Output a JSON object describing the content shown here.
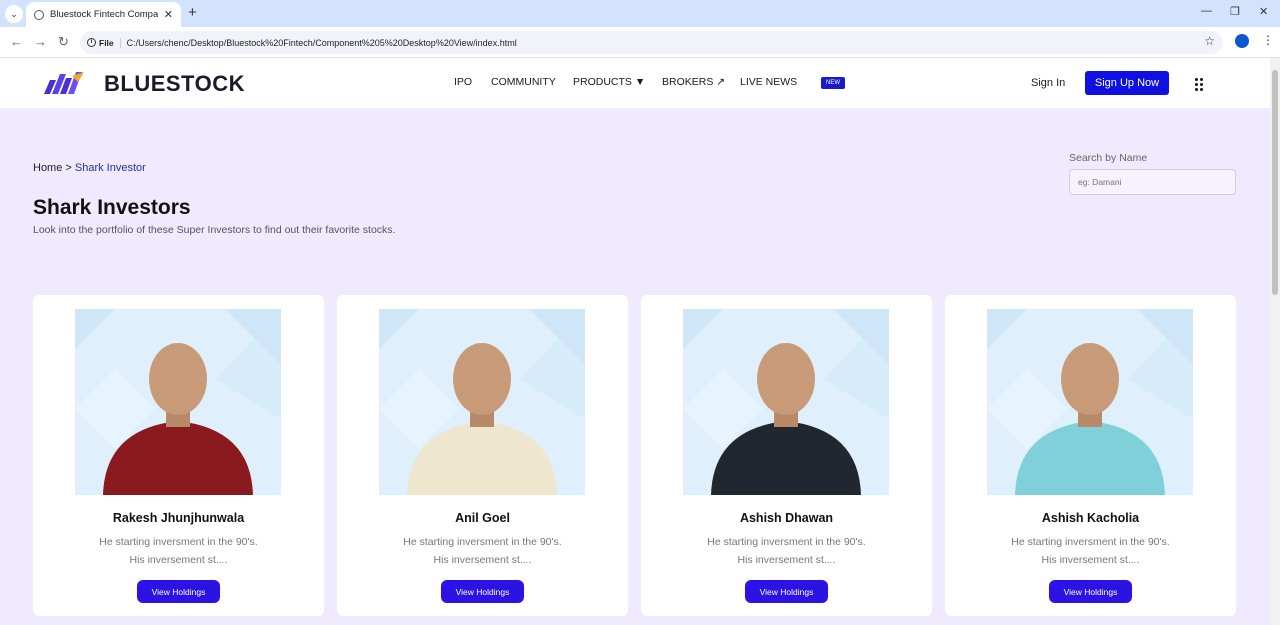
{
  "browser": {
    "tab_title": "Bluestock Fintech Company",
    "address_chip": "File",
    "url": "C:/Users/chenc/Desktop/Bluestock%20Fintech/Component%205%20Desktop%20View/index.html"
  },
  "header": {
    "brand": "BLUESTOCK",
    "nav": [
      "IPO",
      "COMMUNITY",
      "PRODUCTS ▼",
      "BROKERS ↗",
      "LIVE NEWS"
    ],
    "new_badge": "NEW",
    "sign_in": "Sign In",
    "sign_up": "Sign Up Now"
  },
  "breadcrumb": {
    "home": "Home",
    "sep": " > ",
    "current": "Shark Investor"
  },
  "page": {
    "title": "Shark Investors",
    "subtitle": "Look into the portfolio of these Super Investors to find out their favorite stocks."
  },
  "search": {
    "label": "Search by Name",
    "placeholder": "eg: Damani"
  },
  "investors": [
    {
      "name": "Rakesh Jhunjhunwala",
      "desc1": "He starting inversment in the 90's.",
      "desc2": "His inversement st....",
      "button": "View Holdings",
      "shirt": "#8b1a1f"
    },
    {
      "name": "Anil Goel",
      "desc1": "He starting inversment in the 90's.",
      "desc2": "His inversement st....",
      "button": "View Holdings",
      "shirt": "#efe6cf"
    },
    {
      "name": "Ashish Dhawan",
      "desc1": "He starting inversment in the 90's.",
      "desc2": "His inversement st....",
      "button": "View Holdings",
      "shirt": "#22262f"
    },
    {
      "name": "Ashish Kacholia",
      "desc1": "He starting inversment in the 90's.",
      "desc2": "His inversement st....",
      "button": "View Holdings",
      "shirt": "#7fd0d8"
    }
  ]
}
